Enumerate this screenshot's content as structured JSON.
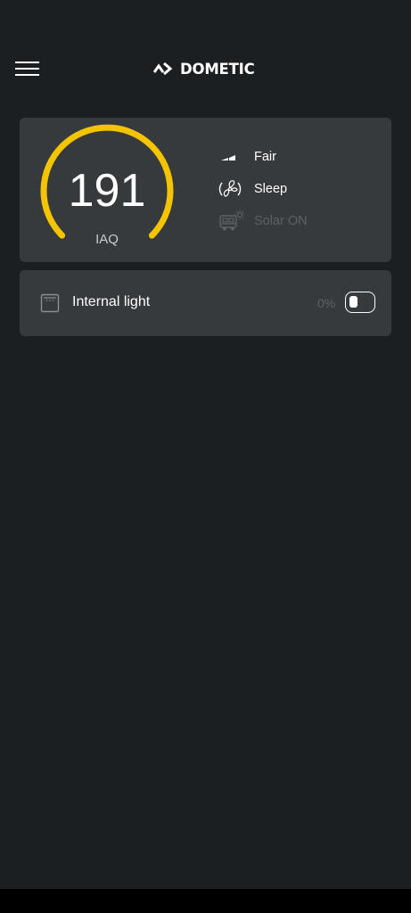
{
  "header": {
    "menu_icon": "hamburger-menu-icon",
    "brand_name": "DOMETIC"
  },
  "iaq_card": {
    "value": "191",
    "label": "IAQ",
    "gauge_color": "#f5c400",
    "status_items": [
      {
        "icon": "signal-bars-icon",
        "label": "Fair",
        "enabled": true
      },
      {
        "icon": "fan-icon",
        "label": "Sleep",
        "enabled": true
      },
      {
        "icon": "solar-van-icon",
        "label": "Solar ON",
        "enabled": false
      }
    ]
  },
  "light_card": {
    "icon": "light-panel-icon",
    "label": "Internal light",
    "percent": "0%",
    "toggle_on": false
  },
  "colors": {
    "background": "#1c1f21",
    "card": "#373a3d",
    "accent": "#f5c400",
    "dim_text": "#5e6165"
  }
}
